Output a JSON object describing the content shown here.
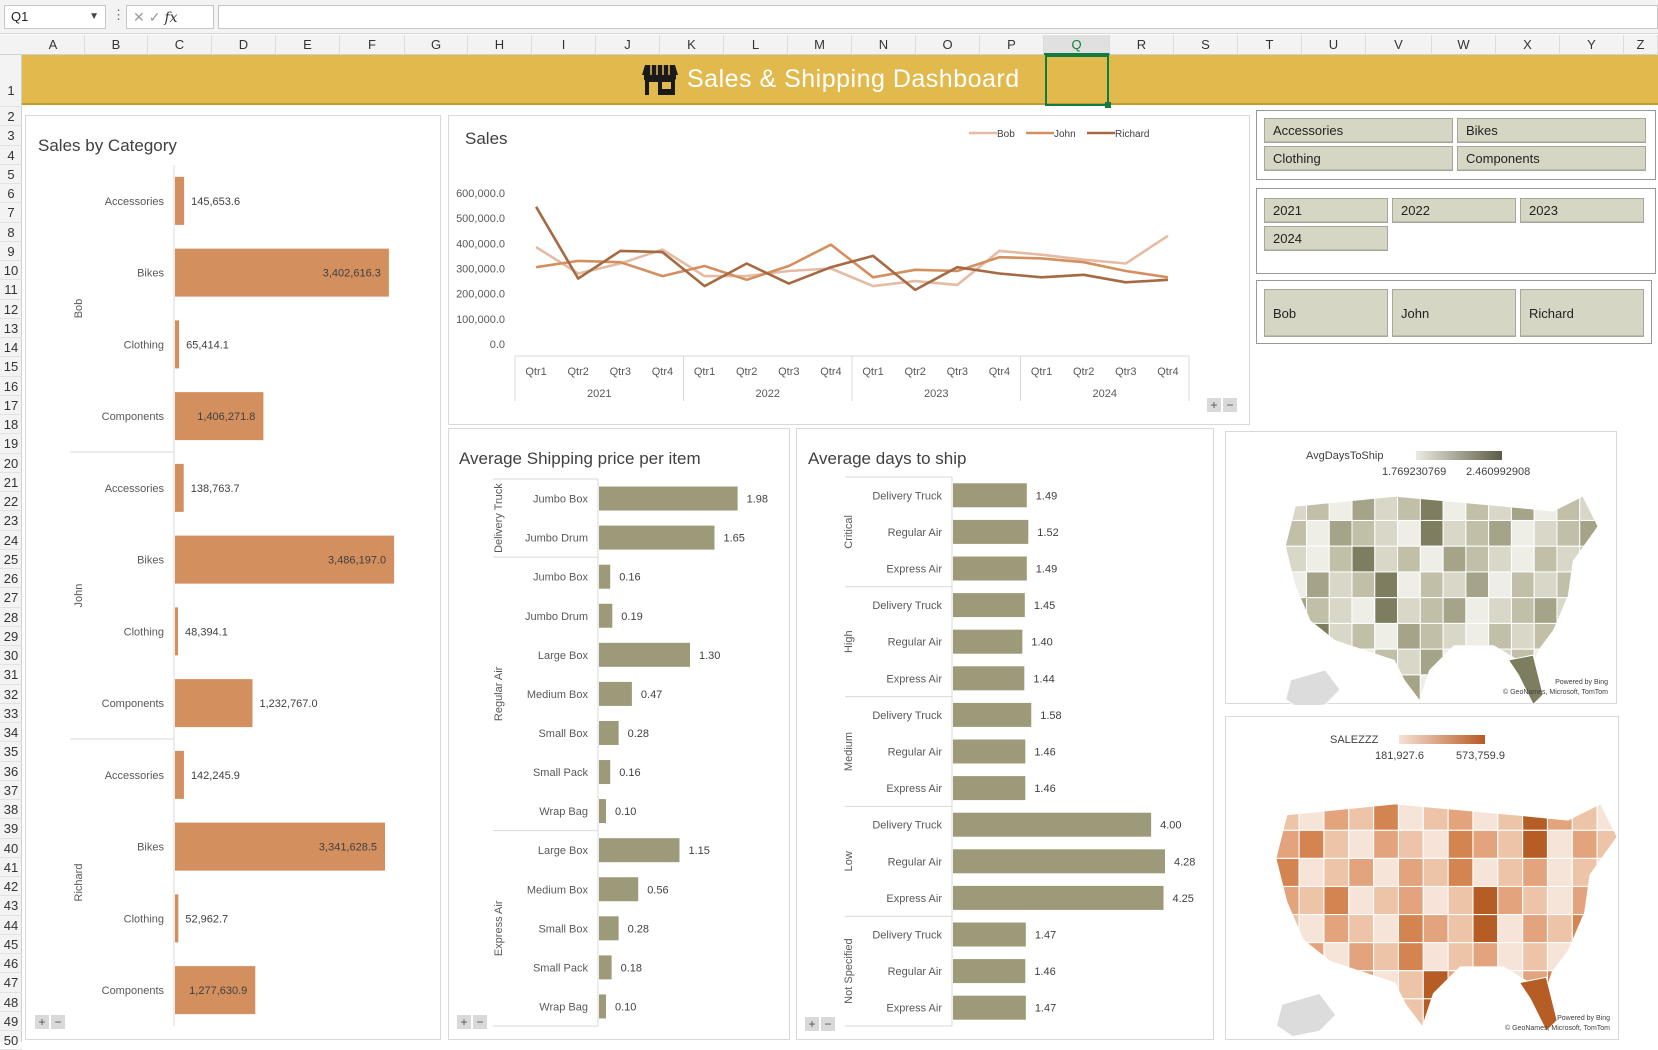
{
  "window": {
    "name_box": "Q1",
    "fx_label": "fx",
    "formula_value": ""
  },
  "columns": [
    "A",
    "B",
    "C",
    "D",
    "E",
    "F",
    "G",
    "H",
    "I",
    "J",
    "K",
    "L",
    "M",
    "N",
    "O",
    "P",
    "Q",
    "R",
    "S",
    "T",
    "U",
    "V",
    "W",
    "X",
    "Y",
    "Z"
  ],
  "rows": [
    "1",
    "2",
    "3",
    "4",
    "5",
    "6",
    "7",
    "8",
    "9",
    "10",
    "11",
    "12",
    "13",
    "14",
    "15",
    "16",
    "17",
    "18",
    "19",
    "20",
    "21",
    "22",
    "23",
    "24",
    "25",
    "26",
    "27",
    "28",
    "29",
    "30",
    "31",
    "32",
    "33",
    "34",
    "35",
    "36",
    "37",
    "38",
    "39",
    "40",
    "41",
    "42",
    "43",
    "44",
    "45",
    "46",
    "47",
    "48",
    "49",
    "50"
  ],
  "selected_column": "Q",
  "selected_row": "1",
  "banner": {
    "title": "Sales & Shipping Dashboard",
    "bg_color": "#e2b94c",
    "icon": "store-icon"
  },
  "colors": {
    "sales_bar": "#d48f5f",
    "shipping_bar": "#9c9a78",
    "bob_line": "#e4bca3",
    "john_line": "#d48f5f",
    "richard_line": "#a56a43"
  },
  "chart_data": [
    {
      "id": "sales_by_category",
      "type": "bar",
      "title": "Sales by Category",
      "orientation": "horizontal",
      "groups": [
        {
          "name": "Bob",
          "categories": [
            "Accessories",
            "Bikes",
            "Clothing",
            "Components"
          ],
          "values": [
            145653.6,
            3402616.3,
            65414.1,
            1406271.8
          ],
          "labels": [
            "145,653.6",
            "3,402,616.3",
            "65,414.1",
            "1,406,271.8"
          ]
        },
        {
          "name": "John",
          "categories": [
            "Accessories",
            "Bikes",
            "Clothing",
            "Components"
          ],
          "values": [
            138763.7,
            3486197.0,
            48394.1,
            1232767.0
          ],
          "labels": [
            "138,763.7",
            "3,486,197.0",
            "48,394.1",
            "1,232,767.0"
          ]
        },
        {
          "name": "Richard",
          "categories": [
            "Accessories",
            "Bikes",
            "Clothing",
            "Components"
          ],
          "values": [
            142245.9,
            3341628.5,
            52962.7,
            1277630.9
          ],
          "labels": [
            "142,245.9",
            "3,341,628.5",
            "52,962.7",
            "1,277,630.9"
          ]
        }
      ]
    },
    {
      "id": "sales_line",
      "type": "line",
      "title": "Sales",
      "legend_position": "top-right",
      "quarters": [
        "Qtr1",
        "Qtr2",
        "Qtr3",
        "Qtr4",
        "Qtr1",
        "Qtr2",
        "Qtr3",
        "Qtr4",
        "Qtr1",
        "Qtr2",
        "Qtr3",
        "Qtr4",
        "Qtr1",
        "Qtr2",
        "Qtr3",
        "Qtr4"
      ],
      "years": [
        "2021",
        "2022",
        "2023",
        "2024"
      ],
      "yticks": [
        "600,000.0",
        "500,000.0",
        "400,000.0",
        "300,000.0",
        "200,000.0",
        "100,000.0",
        "0.0"
      ],
      "ylim": [
        0,
        600000
      ],
      "series": [
        {
          "name": "Bob",
          "values": [
            385000,
            280000,
            320000,
            375000,
            270000,
            270000,
            290000,
            300000,
            230000,
            250000,
            235000,
            370000,
            355000,
            335000,
            320000,
            430000
          ]
        },
        {
          "name": "John",
          "values": [
            305000,
            330000,
            325000,
            270000,
            310000,
            255000,
            310000,
            395000,
            265000,
            295000,
            290000,
            345000,
            340000,
            325000,
            290000,
            265000
          ]
        },
        {
          "name": "Richard",
          "values": [
            545000,
            260000,
            370000,
            365000,
            230000,
            320000,
            240000,
            305000,
            350000,
            215000,
            305000,
            280000,
            265000,
            275000,
            245000,
            255000
          ]
        }
      ]
    },
    {
      "id": "avg_shipping_price",
      "type": "bar",
      "title": "Average Shipping price per item",
      "orientation": "horizontal",
      "groups": [
        {
          "name": "Delivery Truck",
          "categories": [
            "Jumbo Box",
            "Jumbo Drum"
          ],
          "values": [
            1.98,
            1.65
          ],
          "labels": [
            "1.98",
            "1.65"
          ]
        },
        {
          "name": "Regular Air",
          "categories": [
            "Jumbo Box",
            "Jumbo Drum",
            "Large Box",
            "Medium Box",
            "Small Box",
            "Small Pack",
            "Wrap Bag"
          ],
          "values": [
            0.16,
            0.19,
            1.3,
            0.47,
            0.28,
            0.16,
            0.1
          ],
          "labels": [
            "0.16",
            "0.19",
            "1.30",
            "0.47",
            "0.28",
            "0.16",
            "0.10"
          ]
        },
        {
          "name": "Express Air",
          "categories": [
            "Large Box",
            "Medium Box",
            "Small Box",
            "Small Pack",
            "Wrap Bag"
          ],
          "values": [
            1.15,
            0.56,
            0.28,
            0.18,
            0.1
          ],
          "labels": [
            "1.15",
            "0.56",
            "0.28",
            "0.18",
            "0.10"
          ]
        }
      ]
    },
    {
      "id": "avg_days_to_ship",
      "type": "bar",
      "title": "Average days to ship",
      "orientation": "horizontal",
      "groups": [
        {
          "name": "Critical",
          "categories": [
            "Delivery Truck",
            "Regular Air",
            "Express Air"
          ],
          "values": [
            1.49,
            1.52,
            1.49
          ],
          "labels": [
            "1.49",
            "1.52",
            "1.49"
          ]
        },
        {
          "name": "High",
          "categories": [
            "Delivery Truck",
            "Regular Air",
            "Express Air"
          ],
          "values": [
            1.45,
            1.4,
            1.44
          ],
          "labels": [
            "1.45",
            "1.40",
            "1.44"
          ]
        },
        {
          "name": "Medium",
          "categories": [
            "Delivery Truck",
            "Regular Air",
            "Express Air"
          ],
          "values": [
            1.58,
            1.46,
            1.46
          ],
          "labels": [
            "1.58",
            "1.46",
            "1.46"
          ]
        },
        {
          "name": "Low",
          "categories": [
            "Delivery Truck",
            "Regular Air",
            "Express Air"
          ],
          "values": [
            4.0,
            4.28,
            4.25
          ],
          "labels": [
            "4.00",
            "4.28",
            "4.25"
          ]
        },
        {
          "name": "Not Specified",
          "categories": [
            "Delivery Truck",
            "Regular Air",
            "Express Air"
          ],
          "values": [
            1.47,
            1.46,
            1.47
          ],
          "labels": [
            "1.47",
            "1.46",
            "1.47"
          ]
        }
      ]
    }
  ],
  "slicers": {
    "category": [
      "Accessories",
      "Bikes",
      "Clothing",
      "Components"
    ],
    "year": [
      "2021",
      "2022",
      "2023",
      "2024"
    ],
    "person": [
      "Bob",
      "John",
      "Richard"
    ]
  },
  "maps": {
    "days": {
      "legend_title": "AvgDaysToShip",
      "min_label": "1.769230769",
      "max_label": "2.460992908",
      "credit_line1": "Powered by Bing",
      "credit_line2": "© GeoNames, Microsoft, TomTom"
    },
    "sales": {
      "legend_title": "SALEZZZ",
      "min_label": "181,927.6",
      "max_label": "573,759.9",
      "credit_line1": "Powered by Bing",
      "credit_line2": "© GeoNames, Microsoft, TomTom"
    }
  },
  "chart_controls": {
    "plus": "+",
    "minus": "−"
  }
}
